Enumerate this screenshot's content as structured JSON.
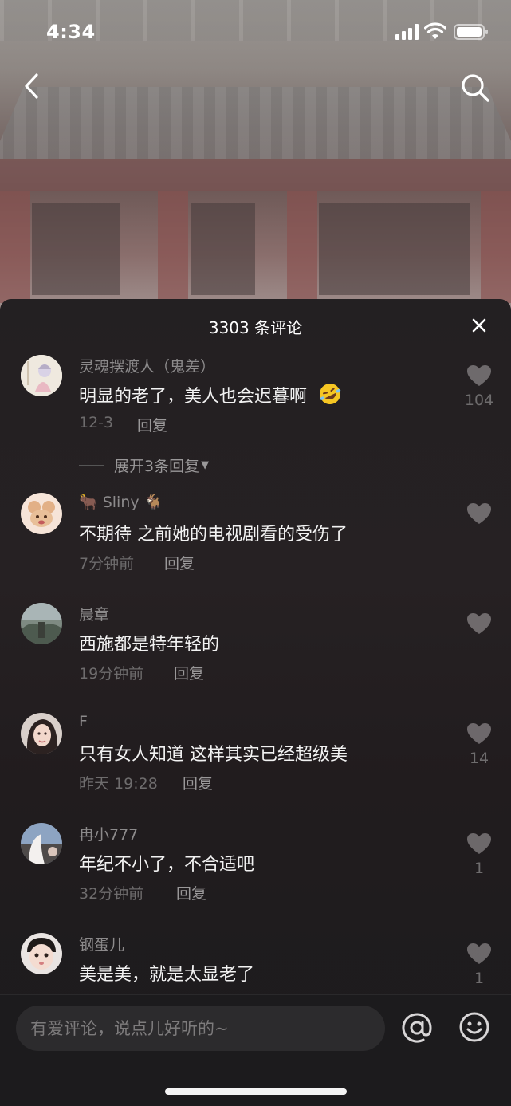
{
  "status_bar": {
    "time": "4:34"
  },
  "header": {
    "back_icon": "chevron-left-icon",
    "search_icon": "search-icon"
  },
  "sheet": {
    "title": "3303 条评论",
    "close_icon": "close-icon"
  },
  "comments": [
    {
      "username": "灵魂摆渡人（鬼差）",
      "text": "明显的老了，美人也会迟暮啊",
      "emoji": "🤣",
      "time": "12-3",
      "reply": "回复",
      "likes": "104",
      "expand": "展开3条回复"
    },
    {
      "username": "🐂 Sliny 🐐",
      "text": "不期待 之前她的电视剧看的受伤了",
      "time": "7分钟前",
      "reply": "回复",
      "likes": ""
    },
    {
      "username": "晨章",
      "text": "西施都是特年轻的",
      "time": "19分钟前",
      "reply": "回复",
      "likes": ""
    },
    {
      "username": "F",
      "text": "只有女人知道 这样其实已经超级美",
      "time": "昨天 19:28",
      "reply": "回复",
      "likes": "14"
    },
    {
      "username": "冉小777",
      "text": "年纪不小了，不合适吧",
      "time": "32分钟前",
      "reply": "回复",
      "likes": "1"
    },
    {
      "username": "钢蛋儿",
      "text": "美是美，就是太显老了",
      "time": "",
      "reply": "",
      "likes": "1"
    }
  ],
  "input": {
    "placeholder": "有爱评论，说点儿好听的~"
  },
  "actions": {
    "at_icon": "at-icon",
    "emoji_icon": "smiley-icon"
  }
}
